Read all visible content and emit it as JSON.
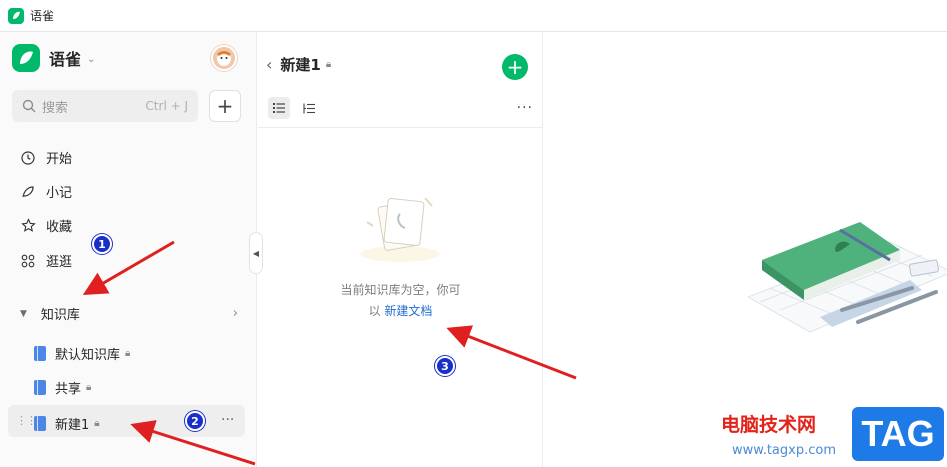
{
  "window": {
    "title": "语雀"
  },
  "sidebar": {
    "brand": "语雀",
    "search_placeholder": "搜索",
    "search_shortcut": "Ctrl + J",
    "add_label": "+",
    "nav": [
      {
        "label": "开始",
        "icon": "clock-icon"
      },
      {
        "label": "小记",
        "icon": "feather-icon"
      },
      {
        "label": "收藏",
        "icon": "star-icon"
      },
      {
        "label": "逛逛",
        "icon": "grid-icon"
      }
    ],
    "kb_section": "知识库",
    "kb_items": [
      {
        "label": "默认知识库",
        "locked": true
      },
      {
        "label": "共享",
        "locked": true
      },
      {
        "label": "新建1",
        "locked": true,
        "selected": true
      }
    ]
  },
  "panel": {
    "title": "新建1",
    "empty_line1": "当前知识库为空，你可",
    "empty_prefix": "以",
    "empty_link": "新建文档"
  },
  "annotations": {
    "badges": [
      "1",
      "2",
      "3"
    ],
    "color": "#1a2ec9",
    "arrow_color": "#e02020"
  },
  "watermark": {
    "site_text": "电脑技术网",
    "url": "www.tagxp.com",
    "tag": "TAG"
  },
  "colors": {
    "brand_green": "#00b96b",
    "link_blue": "#1f6ed4"
  }
}
